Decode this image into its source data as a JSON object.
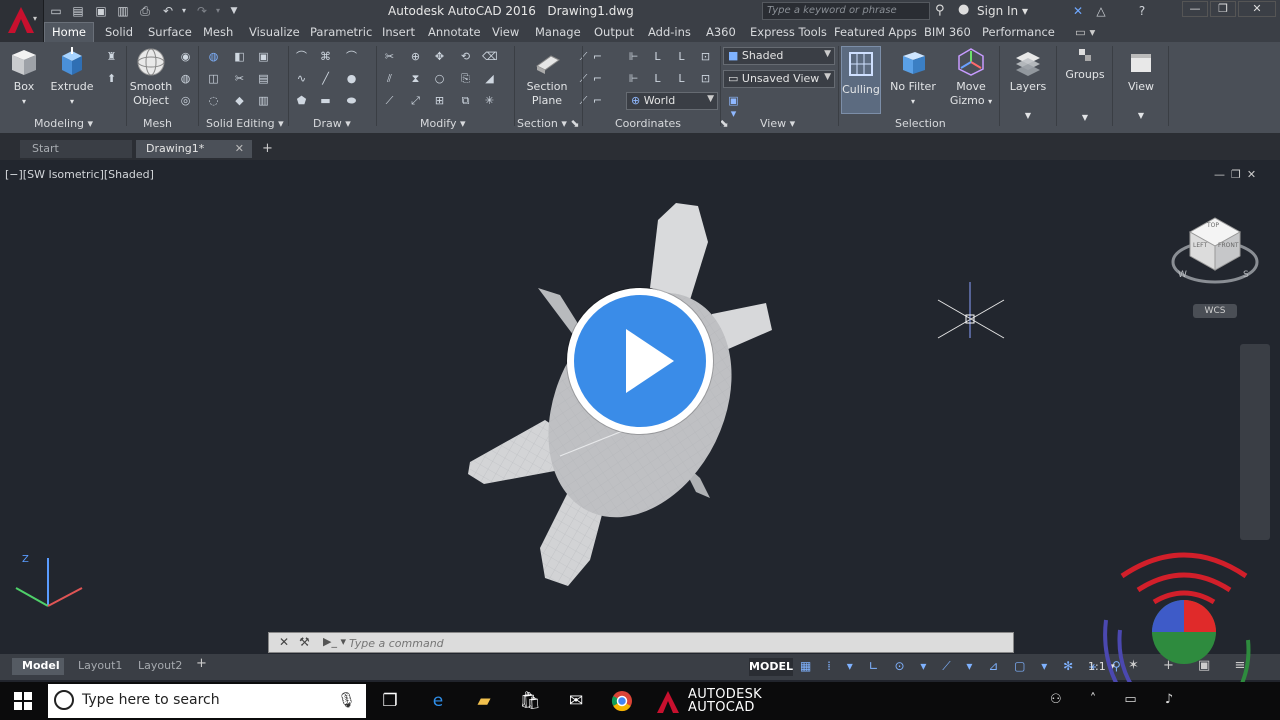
{
  "window": {
    "title": "Autodesk AutoCAD 2016",
    "document": "Drawing1.dwg",
    "search_placeholder": "Type a keyword or phrase",
    "sign_in": "Sign In"
  },
  "ribbon_tabs": [
    "Home",
    "Solid",
    "Surface",
    "Mesh",
    "Visualize",
    "Parametric",
    "Insert",
    "Annotate",
    "View",
    "Manage",
    "Output",
    "Add-ins",
    "A360",
    "Express Tools",
    "Featured Apps",
    "BIM 360",
    "Performance"
  ],
  "ribbon": {
    "box": "Box",
    "extrude": "Extrude",
    "smooth_object_1": "Smooth",
    "smooth_object_2": "Object",
    "section_plane_1": "Section",
    "section_plane_2": "Plane",
    "culling": "Culling",
    "no_filter": "No Filter",
    "move_gizmo_1": "Move",
    "move_gizmo_2": "Gizmo",
    "layers": "Layers",
    "groups": "Groups",
    "view": "View",
    "visual_style": "Shaded",
    "named_view": "Unsaved View",
    "ucs": "World",
    "panels": {
      "modeling": "Modeling",
      "mesh": "Mesh",
      "solid_editing": "Solid Editing",
      "draw": "Draw",
      "modify": "Modify",
      "section": "Section",
      "coordinates": "Coordinates",
      "view": "View",
      "selection": "Selection"
    }
  },
  "file_tabs": {
    "start": "Start",
    "drawing": "Drawing1*"
  },
  "viewport": {
    "label": "[−][SW Isometric][Shaded]",
    "wcs": "WCS",
    "cube_top": "TOP",
    "cube_left": "LEFT",
    "cube_front": "FRONT",
    "compass_w": "W",
    "compass_s": "S"
  },
  "command_line": {
    "placeholder": "Type a command"
  },
  "layout_tabs": {
    "model": "Model",
    "layout1": "Layout1",
    "layout2": "Layout2"
  },
  "status": {
    "model": "MODEL",
    "scale": "1:1"
  },
  "taskbar": {
    "search_placeholder": "Type here to search",
    "autodesk_1": "AUTODESK",
    "autodesk_2": "AUTOCAD"
  },
  "colors": {
    "accent_red": "#c8102e",
    "play_blue": "#3a8ce8",
    "ribbon_bg": "#4a4f57",
    "viewport_bg": "#22262e"
  },
  "icons": [
    "autocad-logo-icon",
    "new-icon",
    "open-icon",
    "save-icon",
    "save-as-icon",
    "print-icon",
    "undo-icon",
    "redo-icon",
    "search-icon",
    "user-icon",
    "exchange-icon",
    "help-icon",
    "box-icon",
    "extrude-icon",
    "smooth-object-icon",
    "section-plane-icon",
    "culling-icon",
    "no-filter-icon",
    "move-gizmo-icon",
    "layers-icon",
    "groups-icon",
    "view-icon",
    "close-icon",
    "add-tab-icon",
    "view-cube-icon",
    "ucs-icon",
    "crosshair-icon",
    "play-icon",
    "windows-icon",
    "microphone-icon",
    "task-view-icon",
    "edge-icon",
    "file-explorer-icon",
    "store-icon",
    "mail-icon",
    "chrome-icon",
    "autocad-app-icon"
  ]
}
